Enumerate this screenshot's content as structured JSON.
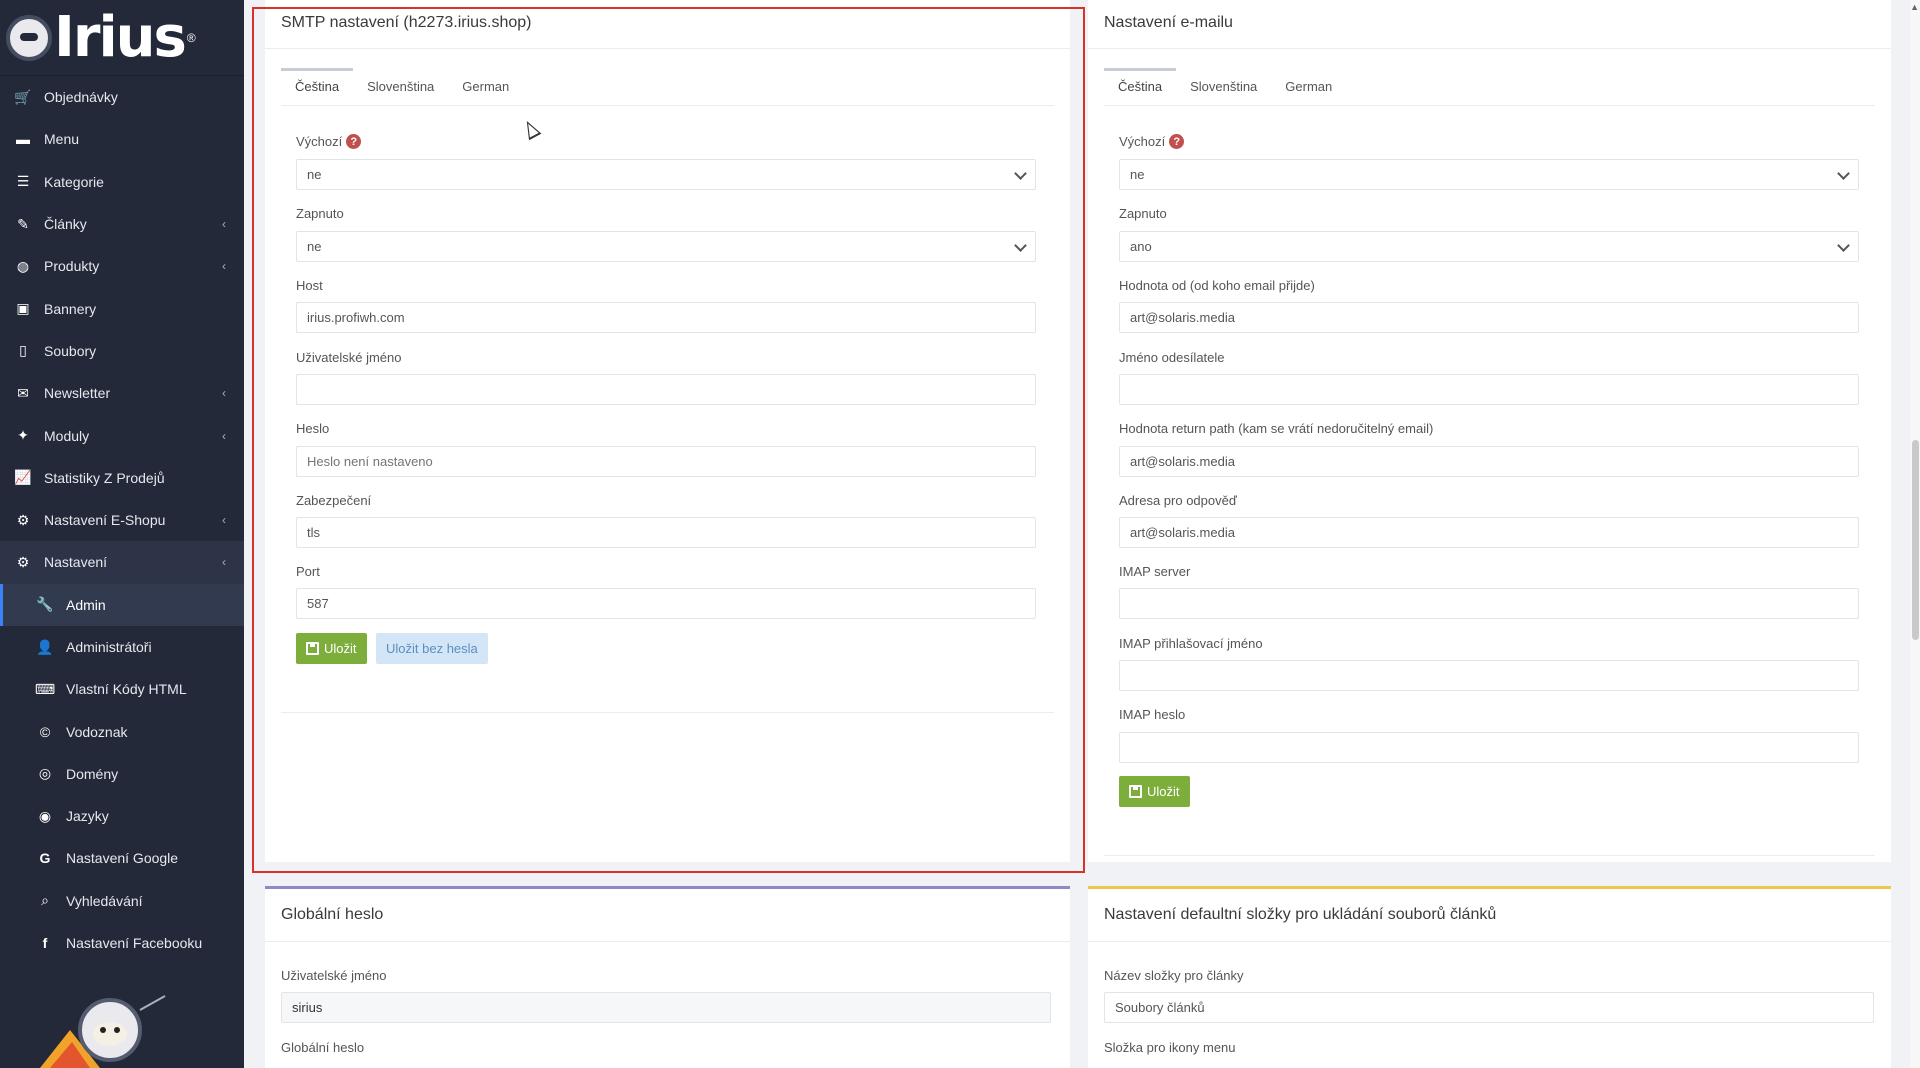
{
  "brand": {
    "logo_text": "Irius",
    "registered": "®"
  },
  "sidebar": {
    "items": [
      {
        "label": "Objednávky",
        "icon": "cart-icon"
      },
      {
        "label": "Menu",
        "icon": "folder-icon"
      },
      {
        "label": "Kategorie",
        "icon": "list-icon"
      },
      {
        "label": "Články",
        "icon": "pencil-icon",
        "has_submenu": true
      },
      {
        "label": "Produkty",
        "icon": "ball-icon",
        "has_submenu": true
      },
      {
        "label": "Bannery",
        "icon": "image-icon"
      },
      {
        "label": "Soubory",
        "icon": "file-icon"
      },
      {
        "label": "Newsletter",
        "icon": "envelope-icon",
        "has_submenu": true
      },
      {
        "label": "Moduly",
        "icon": "puzzle-icon",
        "has_submenu": true
      },
      {
        "label": "Statistiky Z Prodejů",
        "icon": "chart-icon"
      },
      {
        "label": "Nastavení E-Shopu",
        "icon": "cogs-icon",
        "has_submenu": true
      },
      {
        "label": "Nastavení",
        "icon": "cogs-icon",
        "has_submenu": true,
        "open": true
      }
    ],
    "subitems": [
      {
        "label": "Admin",
        "icon": "wrench-icon",
        "active": true
      },
      {
        "label": "Administrátoři",
        "icon": "user-icon"
      },
      {
        "label": "Vlastní Kódy HTML",
        "icon": "html-icon"
      },
      {
        "label": "Vodoznak",
        "icon": "copyright-icon"
      },
      {
        "label": "Domény",
        "icon": "globe-icon"
      },
      {
        "label": "Jazyky",
        "icon": "language-icon"
      },
      {
        "label": "Nastavení Google",
        "icon": "google-icon"
      },
      {
        "label": "Vyhledávání",
        "icon": "search-icon"
      },
      {
        "label": "Nastavení Facebooku",
        "icon": "facebook-icon"
      }
    ]
  },
  "smtp": {
    "title": "SMTP nastavení (h2273.irius.shop)",
    "tabs": [
      "Čeština",
      "Slovenština",
      "German"
    ],
    "default_label": "Výchozí",
    "default_value": "ne",
    "enabled_label": "Zapnuto",
    "enabled_value": "ne",
    "host_label": "Host",
    "host_value": "irius.profiwh.com",
    "username_label": "Uživatelské jméno",
    "username_value": "",
    "password_label": "Heslo",
    "password_placeholder": "Heslo není nastaveno",
    "security_label": "Zabezpečení",
    "security_value": "tls",
    "port_label": "Port",
    "port_value": "587",
    "save_label": "Uložit",
    "save_nopass_label": "Uložit bez hesla"
  },
  "email": {
    "title": "Nastavení e-mailu",
    "tabs": [
      "Čeština",
      "Slovenština",
      "German"
    ],
    "default_label": "Výchozí",
    "default_value": "ne",
    "enabled_label": "Zapnuto",
    "enabled_value": "ano",
    "from_label": "Hodnota od (od koho email přijde)",
    "from_value": "art@solaris.media",
    "sender_label": "Jméno odesílatele",
    "sender_value": "",
    "return_label": "Hodnota return path (kam se vrátí nedoručitelný email)",
    "return_value": "art@solaris.media",
    "reply_label": "Adresa pro odpověď",
    "reply_value": "art@solaris.media",
    "imap_server_label": "IMAP server",
    "imap_server_value": "",
    "imap_login_label": "IMAP přihlašovací jméno",
    "imap_login_value": "",
    "imap_password_label": "IMAP heslo",
    "imap_password_value": "",
    "save_label": "Uložit"
  },
  "global_password": {
    "title": "Globální heslo",
    "username_label": "Uživatelské jméno",
    "username_value": "sirius",
    "password_label": "Globální heslo"
  },
  "folder_settings": {
    "title": "Nastavení defaultní složky pro ukládání souborů článků",
    "folder_label": "Název složky pro články",
    "folder_value": "Soubory článků",
    "icons_label": "Složka pro ikony menu"
  },
  "colors": {
    "sidebar_bg": "#232939",
    "accent_green": "#7dae3c",
    "highlight_red": "#d9322b",
    "card_border_purple": "#8f87c9",
    "card_border_yellow": "#f0c64a"
  }
}
